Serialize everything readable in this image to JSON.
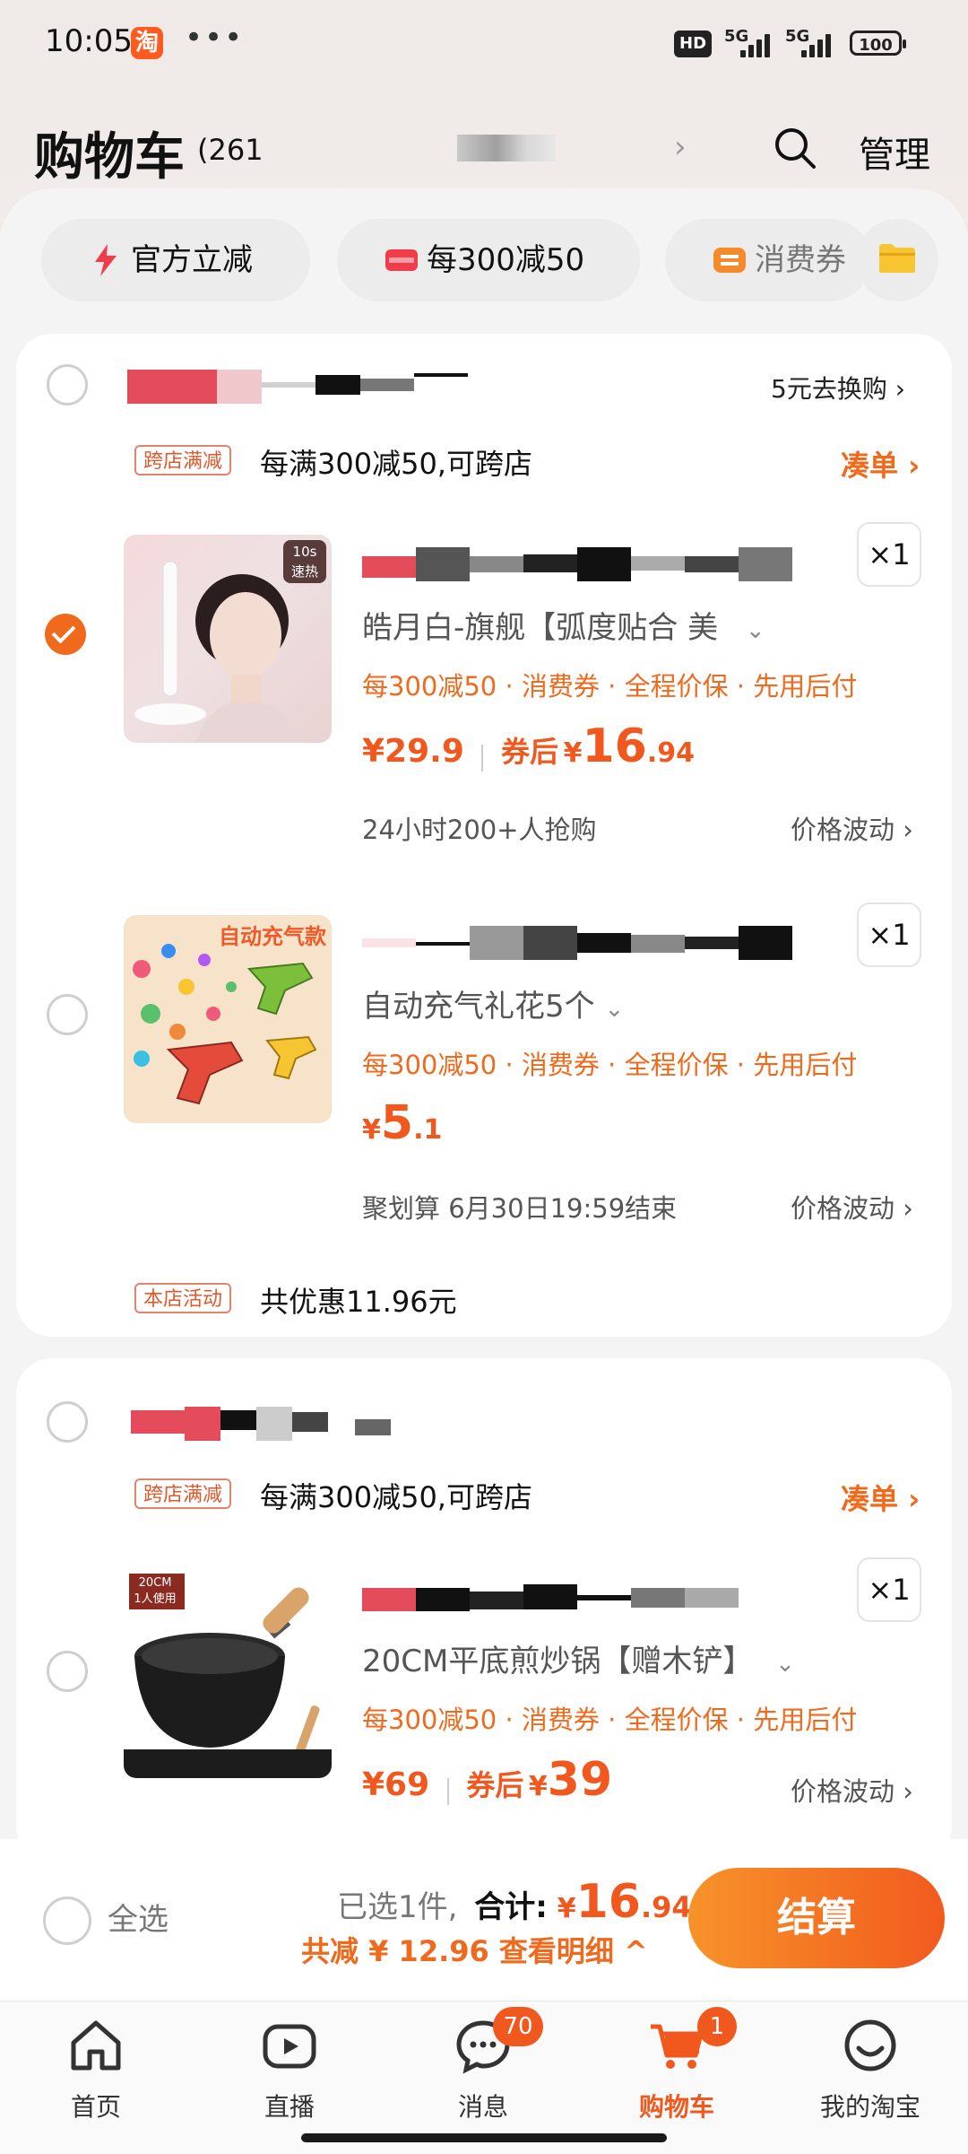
{
  "status_bar": {
    "time": "10:05",
    "taobao_badge": "淘",
    "hd": "HD",
    "net1": "5G",
    "net2": "5G",
    "battery": "100"
  },
  "header": {
    "title": "购物车",
    "count": "(261",
    "manage": "管理"
  },
  "chips": [
    {
      "label": "官方立减",
      "icon": "lightning-icon"
    },
    {
      "label": "每300减50",
      "icon": "coupon-icon"
    },
    {
      "label": "消费券",
      "icon": "voucher-icon"
    }
  ],
  "store1": {
    "exchange": "5元去换购 ›",
    "promo_tag": "跨店满减",
    "promo_text": "每满300减50,可跨店",
    "coudan": "凑单 ›",
    "items": [
      {
        "thumb_badge": "10s\n速热",
        "qty": "×1",
        "sku": "皓月白-旗舰【弧度贴合 美",
        "benefits": "每300减50 · 消费券 · 全程价保 · 先用后付",
        "price": "¥29.9",
        "after_label": "券后",
        "after_price_int": "16",
        "after_price_dec": ".94",
        "meta": "24小时200+人抢购",
        "fluct": "价格波动 ›"
      },
      {
        "thumb_text": "自动充气款",
        "qty": "×1",
        "sku": "自动充气礼花5个",
        "benefits": "每300减50 · 消费券 · 全程价保 · 先用后付",
        "price_int": "5",
        "price_dec": ".1",
        "meta": "聚划算 6月30日19:59结束",
        "fluct": "价格波动 ›"
      }
    ],
    "shop_tag": "本店活动",
    "shop_text": "共优惠11.96元"
  },
  "store2": {
    "promo_tag": "跨店满减",
    "promo_text": "每满300减50,可跨店",
    "coudan": "凑单 ›",
    "items": [
      {
        "thumb_badge": "20CM\n1人使用",
        "qty": "×1",
        "sku": "20CM平底煎炒锅【赠木铲】",
        "benefits": "每300减50 · 消费券 · 全程价保 · 先用后付",
        "price": "¥69",
        "after_label": "券后",
        "after_price": "39",
        "fluct": "价格波动 ›"
      }
    ]
  },
  "settle": {
    "select_all": "全选",
    "selected": "已选1件,",
    "total_label": "合计:",
    "total_int": "16",
    "total_dec": ".94",
    "detail": "共减 ¥ 12.96 查看明细 ^",
    "checkout": "结算"
  },
  "tabs": [
    {
      "label": "首页",
      "icon": "home-icon"
    },
    {
      "label": "直播",
      "icon": "live-icon"
    },
    {
      "label": "消息",
      "icon": "message-icon",
      "badge": "70"
    },
    {
      "label": "购物车",
      "icon": "cart-icon",
      "badge": "1",
      "active": true
    },
    {
      "label": "我的淘宝",
      "icon": "profile-icon"
    }
  ],
  "colors": {
    "accent": "#f0581e",
    "accent_light": "#f7932a"
  }
}
